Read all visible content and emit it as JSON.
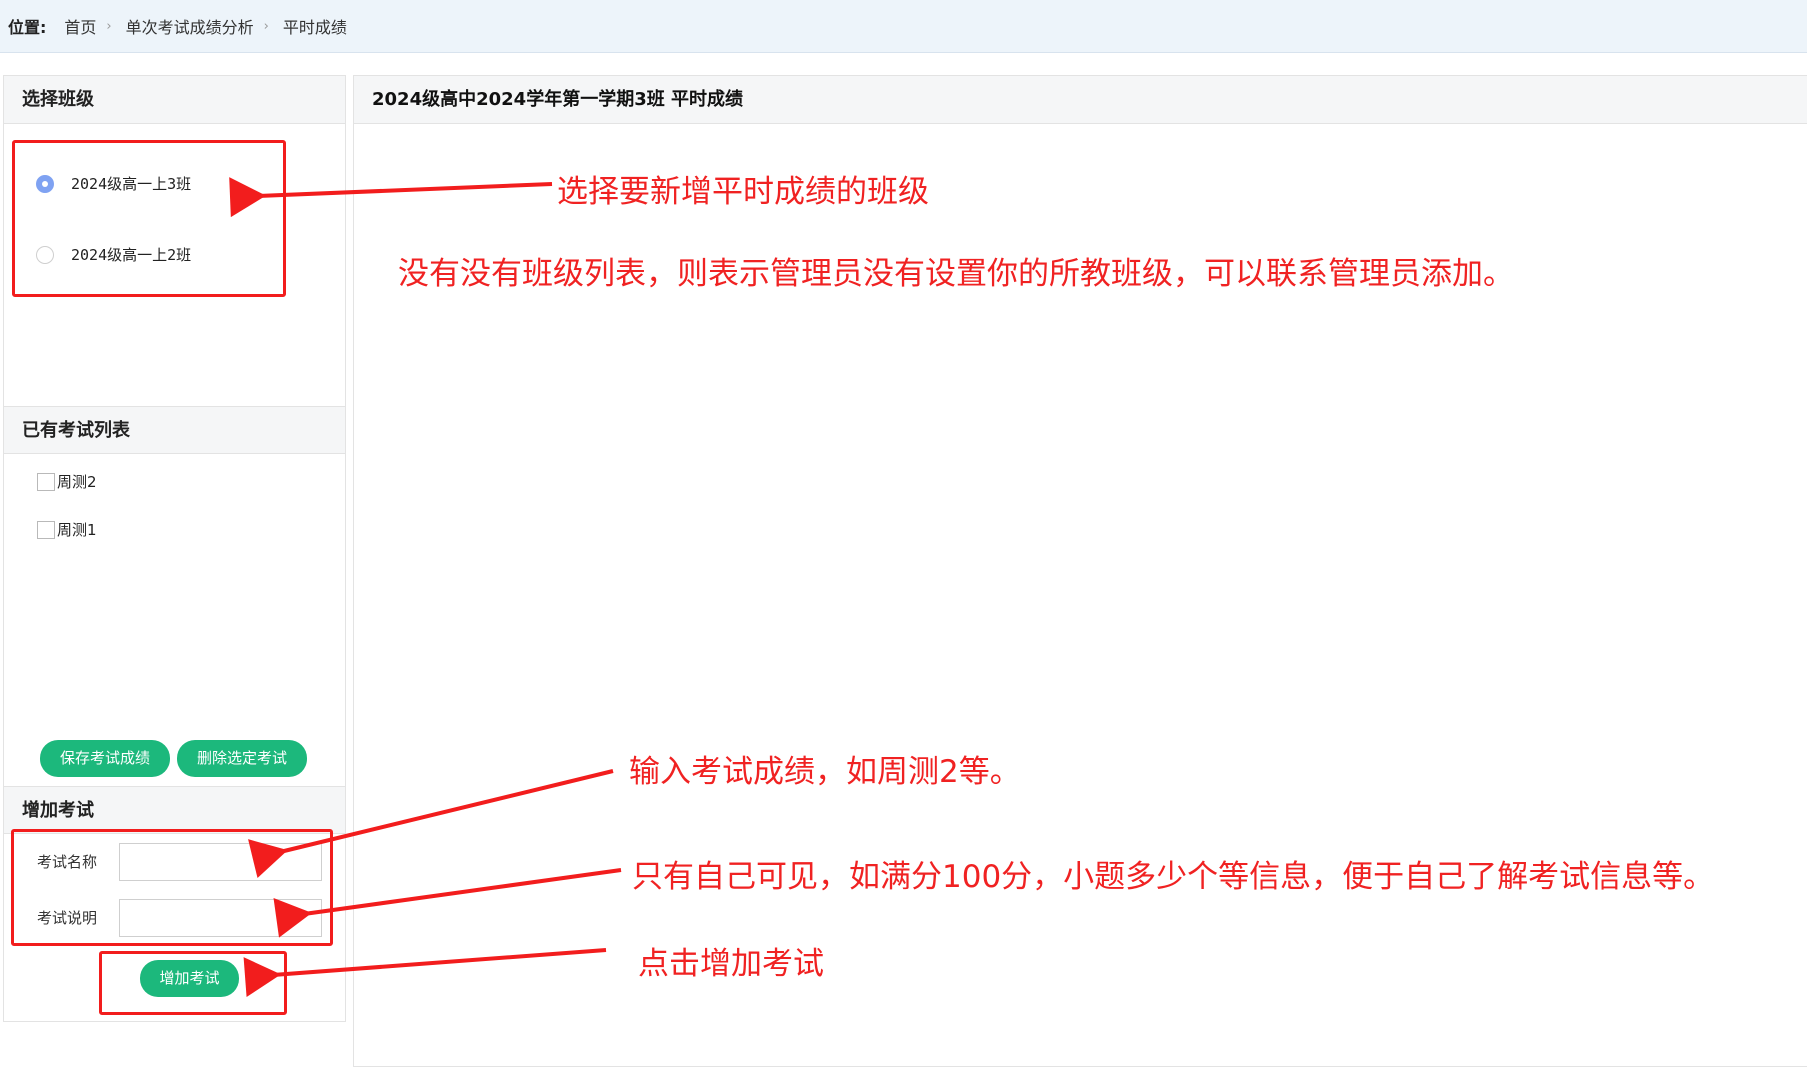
{
  "breadcrumb": {
    "label": "位置:",
    "items": [
      "首页",
      "单次考试成绩分析",
      "平时成绩"
    ],
    "separator": "›"
  },
  "left": {
    "class_section_title": "选择班级",
    "classes": [
      {
        "label": "2024级高一上3班",
        "selected": true
      },
      {
        "label": "2024级高一上2班",
        "selected": false
      }
    ],
    "exam_section_title": "已有考试列表",
    "exams": [
      {
        "label": "周测2",
        "checked": false
      },
      {
        "label": "周测1",
        "checked": false
      }
    ],
    "save_button": "保存考试成绩",
    "delete_button": "删除选定考试",
    "add_section_title": "增加考试",
    "exam_name_label": "考试名称",
    "exam_name_value": "",
    "exam_desc_label": "考试说明",
    "exam_desc_value": "",
    "add_button": "增加考试"
  },
  "right": {
    "title": "2024级高中2024学年第一学期3班 平时成绩"
  },
  "annotations": {
    "select_class": "选择要新增平时成绩的班级",
    "no_class_list": "没有没有班级列表，则表示管理员没有设置你的所教班级，可以联系管理员添加。",
    "enter_exam": "输入考试成绩，如周测2等。",
    "self_visible": "只有自己可见，如满分100分，小题多少个等信息，便于自己了解考试信息等。",
    "click_add": "点击增加考试"
  },
  "colors": {
    "accent_green": "#1cb87c",
    "annotation_red": "#f02222",
    "radio_blue": "#7fa2f2",
    "topbar_bg": "#edf4fa"
  }
}
